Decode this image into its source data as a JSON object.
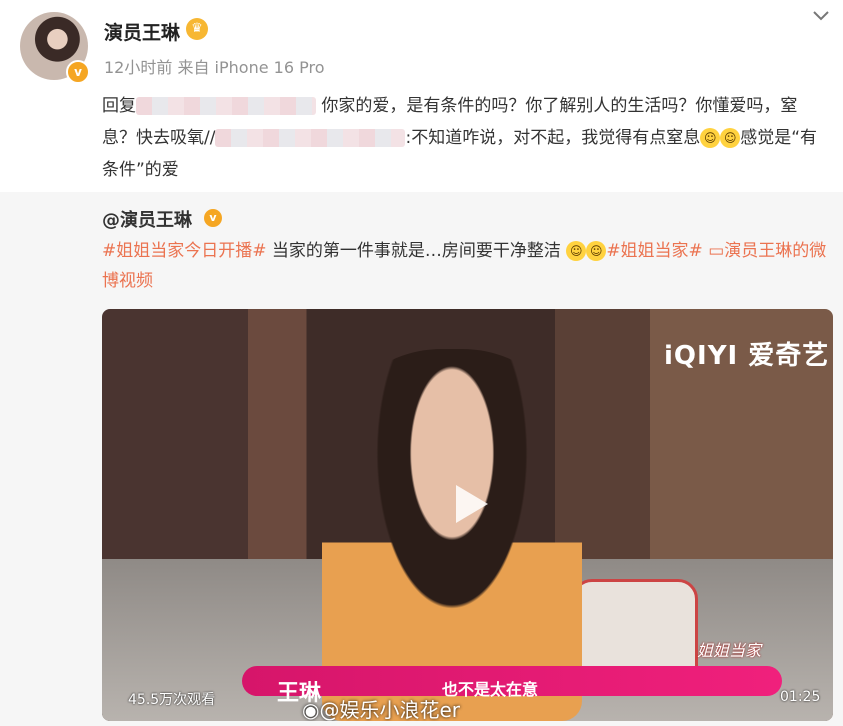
{
  "post": {
    "author": "演员王琳",
    "time": "12小时前",
    "source": "来自 iPhone 16 Pro",
    "text_parts": {
      "p1": "回复",
      "p2": "你家的爱，是有条件的吗？你了解别人的生活吗？你懂爱吗，窒息？快去吸氧//",
      "p3": ":不知道咋说，对不起，我觉得有点窒息",
      "p4": "感觉是“有条件”的爱"
    }
  },
  "repost": {
    "author": "@演员王琳",
    "tag1": "#姐姐当家今日开播#",
    "body": " 当家的第一件事就是…房间要干净整洁 ",
    "tag2": "#姐姐当家#",
    "video_link": "演员王琳的微博视频"
  },
  "video": {
    "brand": "iQIYI 爱奇艺",
    "name_tag": "王琳",
    "caption": "也不是太在意",
    "show_logo": "姐姐当家",
    "watermark": "@娱乐小浪花er",
    "views": "45.5万次观看",
    "duration": "01:25"
  },
  "colors": {
    "accent": "#eb7350",
    "verified": "#f5a623",
    "lower_bar": "#e8196f"
  },
  "icons": [
    "verified-badge-icon",
    "crown-icon",
    "chevron-down-icon",
    "laugh-cry-emoji-icon",
    "video-camera-icon",
    "play-icon",
    "weibo-logo-icon"
  ]
}
